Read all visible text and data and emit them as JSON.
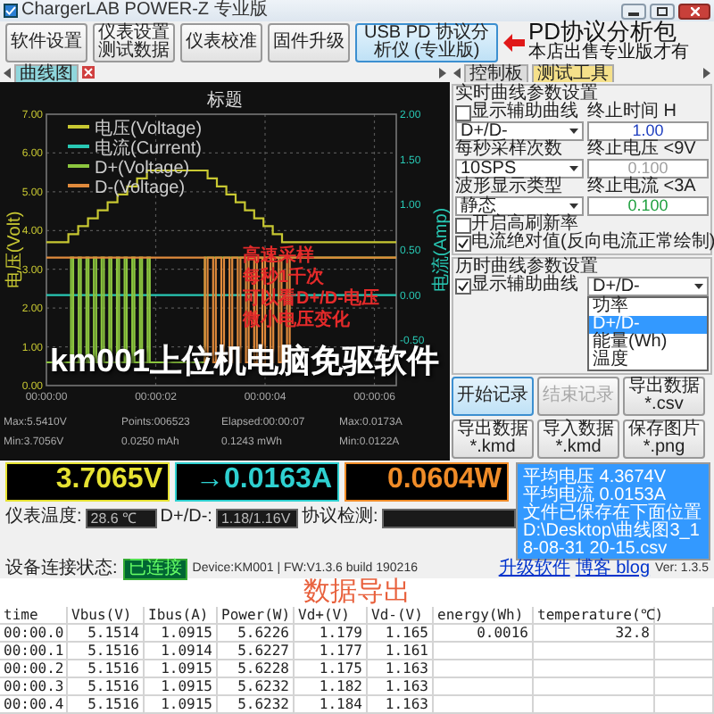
{
  "window": {
    "title": "ChargerLAB POWER-Z 专业版"
  },
  "toolbar": [
    {
      "label": "软件设置",
      "highlighted": false
    },
    {
      "label": "仪表设置测试数据",
      "highlighted": false
    },
    {
      "label": "仪表校准",
      "highlighted": false
    },
    {
      "label": "固件升级",
      "highlighted": false
    },
    {
      "label": "USB PD 协议分析仪 (专业版)",
      "highlighted": true
    }
  ],
  "promo": {
    "title": "PD协议分析包",
    "subtitle": "本店出售专业版才有"
  },
  "left_tabs": [
    {
      "label": "曲线图",
      "selected": true
    }
  ],
  "right_tabs": [
    {
      "label": "控制板",
      "selected": false
    },
    {
      "label": "测试工具",
      "selected": true
    }
  ],
  "chart": {
    "title": "标题",
    "left_axis": "电压(Volt)",
    "right_axis": "电流(Amp)",
    "left_ticks": [
      "7.00",
      "6.00",
      "5.00",
      "4.00",
      "3.00",
      "2.00",
      "1.00",
      "0.00"
    ],
    "right_ticks": [
      "2.00",
      "1.50",
      "1.00",
      "0.50",
      "0.00",
      "-0.50"
    ],
    "x_ticks": [
      "00:00:00",
      "00:00:02",
      "00:00:04",
      "00:00:06"
    ],
    "legend": [
      {
        "label": "电压(Voltage)",
        "color": "#c8c832"
      },
      {
        "label": "电流(Current)",
        "color": "#28c8b4"
      },
      {
        "label": "D+(Voltage)",
        "color": "#8cc63f"
      },
      {
        "label": "D-(Voltage)",
        "color": "#e08a3c"
      }
    ],
    "stats": [
      [
        "Max:5.5410V",
        "Points:006523",
        "Elapsed:00:00:07",
        "Max:0.0173A"
      ],
      [
        "Min:3.7056V",
        "0.0250 mAh",
        "0.1243 mWh",
        "Min:0.0122A"
      ]
    ],
    "captions": [
      "高速采样",
      "每秒1千次",
      "可以看D+/D-电压",
      "微小电压变化"
    ],
    "banner": "km001上位机电脑免驱软件"
  },
  "realtime": {
    "title": "实时曲线参数设置",
    "show_aux": {
      "label": "显示辅助曲线",
      "checked": false
    },
    "curve": "D+/D-",
    "selects": [
      {
        "label": "每秒采样次数",
        "value": "10SPS"
      },
      {
        "label": "波形显示类型",
        "value": "静态"
      }
    ],
    "fields": [
      {
        "label": "终止时间 H",
        "value": "1.00",
        "color": "#2040c0"
      },
      {
        "label": "终止电压 <9V",
        "value": "0.100",
        "color": "#a0a0a0"
      },
      {
        "label": "终止电流 <3A",
        "value": "0.100",
        "color": "#20a040"
      }
    ],
    "options": [
      {
        "label": "开启高刷新率",
        "checked": false
      },
      {
        "label": "电流绝对值(反向电流正常绘制)",
        "checked": true
      }
    ]
  },
  "history": {
    "title": "历时曲线参数设置",
    "show_aux": {
      "label": "显示辅助曲线",
      "checked": true
    },
    "curve": "D+/D-",
    "options": [
      {
        "label": "功率",
        "selected": false
      },
      {
        "label": "D+/D-",
        "selected": true
      },
      {
        "label": "能量(Wh)",
        "selected": false
      },
      {
        "label": "温度",
        "selected": false
      }
    ]
  },
  "buttons": [
    {
      "label": "开始记录",
      "disabled": false,
      "highlighted": true
    },
    {
      "label": "结束记录",
      "disabled": true,
      "highlighted": false
    },
    {
      "label": "导出数据 *.csv",
      "disabled": false,
      "highlighted": false
    },
    {
      "label": "导出数据 *.kmd",
      "disabled": false,
      "highlighted": false
    },
    {
      "label": "导入数据 *.kmd",
      "disabled": false,
      "highlighted": false
    },
    {
      "label": "保存图片 *.png",
      "disabled": false,
      "highlighted": false
    }
  ],
  "readouts": [
    {
      "text": "3.7065V",
      "color": "#e6e232"
    },
    {
      "text": "→0.0163A",
      "color": "#2ed0d0"
    },
    {
      "text": "0.0604W",
      "color": "#f08c28"
    }
  ],
  "log": [
    "平均电压 4.3674V",
    "平均电流 0.0153A",
    "文件已保存在下面位置",
    "D:\\Desktop\\曲线图3_18-08-31 20-15.csv"
  ],
  "info": {
    "temperature": {
      "label": "仪表温度:",
      "value": "28.6 ℃"
    },
    "dpdm": {
      "label": "D+/D-:",
      "value": "1.18/1.16V"
    },
    "protocol": {
      "label": "协议检测:"
    }
  },
  "status": {
    "label": "设备连接状态:",
    "state": "已连接",
    "device": "Device:KM001 | FW:V1.3.6 build 190216",
    "links": [
      "升级软件",
      "博客 blog"
    ],
    "version": "Ver: 1.3.5"
  },
  "export_title": "数据导出",
  "table": {
    "columns": [
      "time",
      "Vbus(V)",
      "Ibus(A)",
      "Power(W)",
      "Vd+(V)",
      "Vd-(V)",
      "energy(Wh)",
      "temperature(℃)"
    ],
    "rows": [
      [
        "00:00.0",
        "5.1514",
        "1.0915",
        "5.6226",
        "1.179",
        "1.165",
        "0.0016",
        "32.8"
      ],
      [
        "00:00.1",
        "5.1516",
        "1.0914",
        "5.6227",
        "1.177",
        "1.161"
      ],
      [
        "00:00.2",
        "5.1516",
        "1.0915",
        "5.6228",
        "1.175",
        "1.163"
      ],
      [
        "00:00.3",
        "5.1516",
        "1.0915",
        "5.6232",
        "1.182",
        "1.163"
      ],
      [
        "00:00.4",
        "5.1516",
        "1.0915",
        "5.6232",
        "1.184",
        "1.163"
      ]
    ]
  }
}
